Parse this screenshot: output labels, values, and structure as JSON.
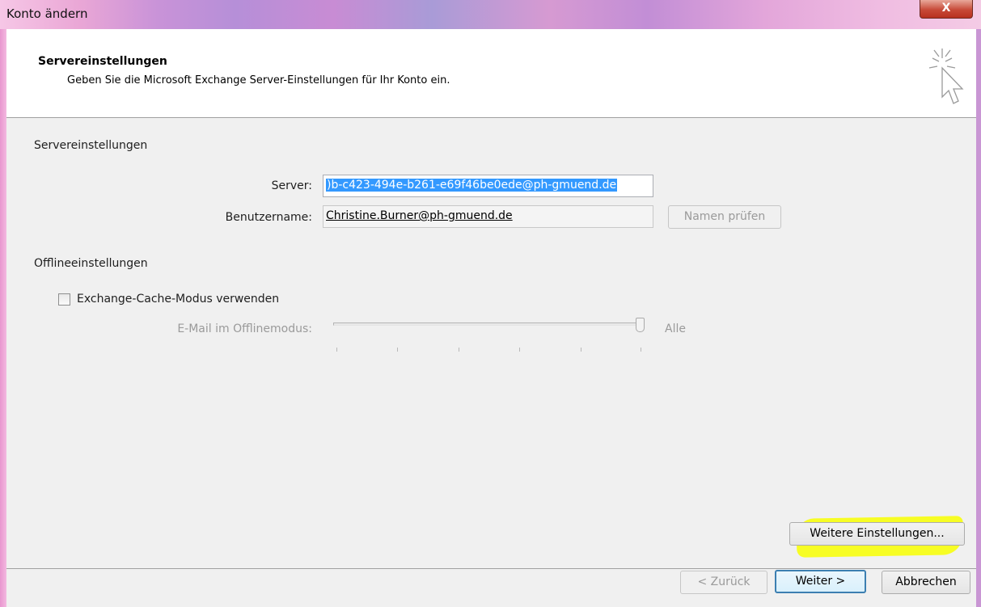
{
  "window": {
    "title": "Konto ändern",
    "close_glyph": "X"
  },
  "header": {
    "title": "Servereinstellungen",
    "subtitle": "Geben Sie die Microsoft Exchange Server-Einstellungen für Ihr Konto ein.",
    "icon": "wizard-cursor-icon"
  },
  "server_section": {
    "heading": "Servereinstellungen",
    "server_label": "Server:",
    "server_value": ")b-c423-494e-b261-e69f46be0ede@ph-gmuend.de",
    "username_label": "Benutzername:",
    "username_value": "Christine.Burner@ph-gmuend.de",
    "check_names_button": "Namen prüfen"
  },
  "offline_section": {
    "heading": "Offlineeinstellungen",
    "cache_checkbox_label": "Exchange-Cache-Modus verwenden",
    "cache_checked": false,
    "mail_offline_label": "E-Mail im Offlinemodus:",
    "slider_value_label": "Alle",
    "slider_position": 1.0
  },
  "buttons": {
    "more_settings": "Weitere Einstellungen...",
    "back": "< Zurück",
    "next": "Weiter >",
    "cancel": "Abbrechen"
  },
  "colors": {
    "selection": "#3399ff",
    "highlight": "#f8ff00",
    "default_button_border": "#3c7fb1"
  }
}
